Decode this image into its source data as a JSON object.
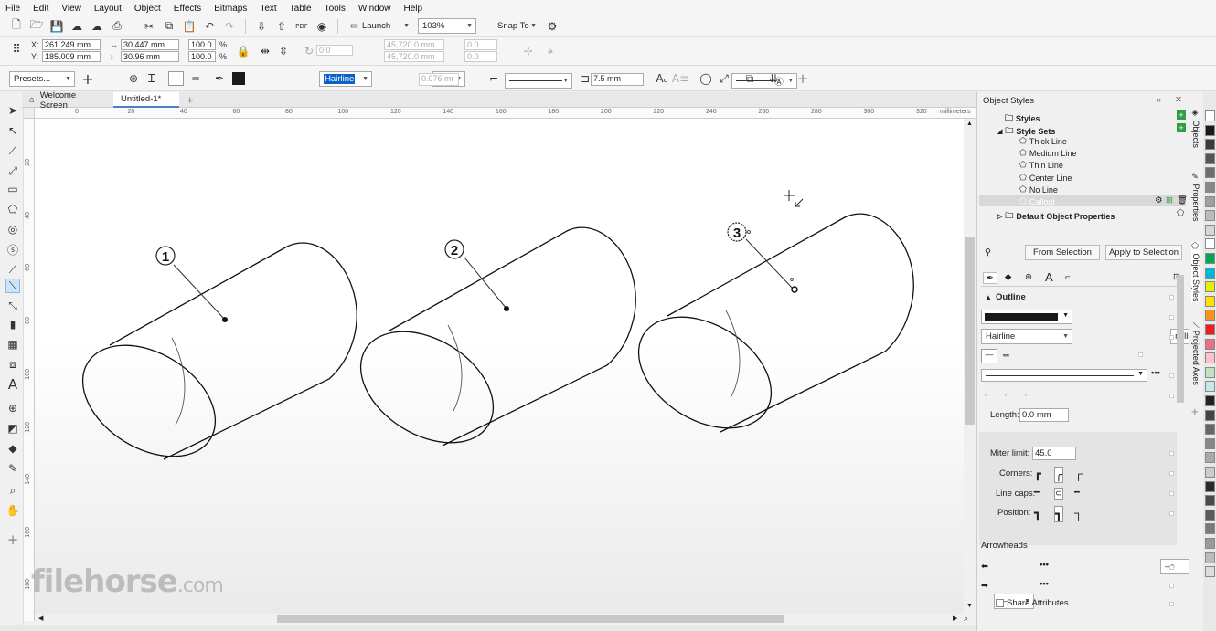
{
  "menu": [
    "File",
    "Edit",
    "View",
    "Layout",
    "Object",
    "Effects",
    "Bitmaps",
    "Text",
    "Table",
    "Tools",
    "Window",
    "Help"
  ],
  "stdbar": {
    "launch_label": "Launch",
    "zoom_value": "103%",
    "snap_label": "Snap To"
  },
  "props": {
    "x_label": "X:",
    "x_value": "261.249 mm",
    "y_label": "Y:",
    "y_value": "185.009 mm",
    "w_value": "30.447 mm",
    "h_value": "30.96 mm",
    "sx_value": "100.0",
    "sy_value": "100.0",
    "pct": "%",
    "angle_value": "0.0",
    "cx_value": "45,720.0 mm",
    "cy_value": "45,720.0 mm",
    "ox_value": "0.0",
    "oy_value": "0.0"
  },
  "props2": {
    "presets": "Presets...",
    "outline_width": "Hairline",
    "width_value": "0.076 mr",
    "callout_value": "7.5 mm"
  },
  "doctabs": {
    "welcome": "Welcome Screen",
    "untitled": "Untitled-1*"
  },
  "ruler": {
    "top_labels": [
      "0",
      "20",
      "40",
      "60",
      "80",
      "100",
      "120",
      "140",
      "160",
      "180",
      "200",
      "220",
      "240",
      "260",
      "280",
      "300",
      "320"
    ],
    "unit": "millimeters",
    "left_labels": [
      "20",
      "40",
      "60",
      "80",
      "100",
      "120",
      "140",
      "160",
      "180"
    ]
  },
  "callouts": [
    "1",
    "2",
    "3"
  ],
  "panel": {
    "title": "Object Styles",
    "tree": {
      "styles": "Styles",
      "style_sets": "Style Sets",
      "children": [
        "Thick Line",
        "Medium Line",
        "Thin Line",
        "Center Line",
        "No Line",
        "Callout"
      ],
      "default_props": "Default Object Properties"
    },
    "from_selection": "From Selection",
    "apply_selection": "Apply to Selection",
    "outline_heading": "Outline",
    "width": "Hairline",
    "units": "millimeters",
    "length_label": "Length:",
    "length_value": "0.0 mm",
    "miter_label": "Miter limit:",
    "miter_value": "45.0",
    "corners_label": "Corners:",
    "linecaps_label": "Line caps:",
    "position_label": "Position:",
    "arrowheads_label": "Arrowheads",
    "share_label": "Share Attributes"
  },
  "docker_tabs": [
    "Objects",
    "Properties",
    "Object Styles",
    "Projected Axes"
  ],
  "palette": [
    "#ffffff",
    "#1a1a1a",
    "#3a3a3a",
    "#555555",
    "#6e6e6e",
    "#888888",
    "#a0a0a0",
    "#bcbcbc",
    "#d6d6d6",
    "#ffffff",
    "#00a651",
    "#00b8d4",
    "#e6f000",
    "#ffe000",
    "#f7941d",
    "#ed1c24",
    "#ee6e8a",
    "#ffc0cb",
    "#bde3c3",
    "#c9e6ef",
    "#222222",
    "#444444",
    "#666666",
    "#888888",
    "#aaaaaa",
    "#cccccc",
    "#2a2a2a",
    "#4a4a4a",
    "#5a5a5a",
    "#7a7a7a",
    "#9a9a9a",
    "#bbbbbb",
    "#dddddd"
  ],
  "watermark": {
    "main": "filehorse",
    "tld": ".com"
  }
}
